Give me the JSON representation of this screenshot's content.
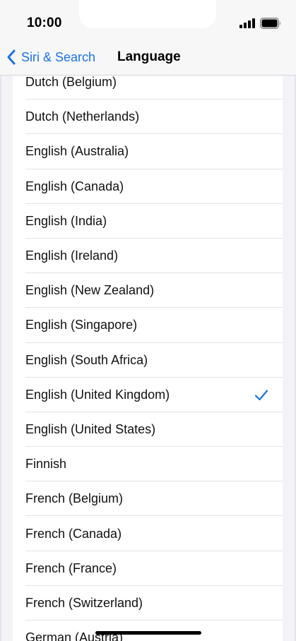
{
  "status_bar": {
    "time": "10:00",
    "signal_icon": "cellular-signal-icon",
    "battery_icon": "battery-icon"
  },
  "nav": {
    "back_label": "Siri & Search",
    "back_icon": "chevron-left-icon",
    "title": "Language"
  },
  "colors": {
    "accent": "#1a73e8",
    "background": "#f2f2f7",
    "cell": "#ffffff"
  },
  "languages": [
    {
      "label": "Dutch (Belgium)",
      "selected": false
    },
    {
      "label": "Dutch (Netherlands)",
      "selected": false
    },
    {
      "label": "English (Australia)",
      "selected": false
    },
    {
      "label": "English (Canada)",
      "selected": false
    },
    {
      "label": "English (India)",
      "selected": false
    },
    {
      "label": "English (Ireland)",
      "selected": false
    },
    {
      "label": "English (New Zealand)",
      "selected": false
    },
    {
      "label": "English (Singapore)",
      "selected": false
    },
    {
      "label": "English (South Africa)",
      "selected": false
    },
    {
      "label": "English (United Kingdom)",
      "selected": true
    },
    {
      "label": "English (United States)",
      "selected": false
    },
    {
      "label": "Finnish",
      "selected": false
    },
    {
      "label": "French (Belgium)",
      "selected": false
    },
    {
      "label": "French (Canada)",
      "selected": false
    },
    {
      "label": "French (France)",
      "selected": false
    },
    {
      "label": "French (Switzerland)",
      "selected": false
    },
    {
      "label": "German (Austria)",
      "selected": false
    }
  ],
  "selected_icon": "checkmark-icon"
}
